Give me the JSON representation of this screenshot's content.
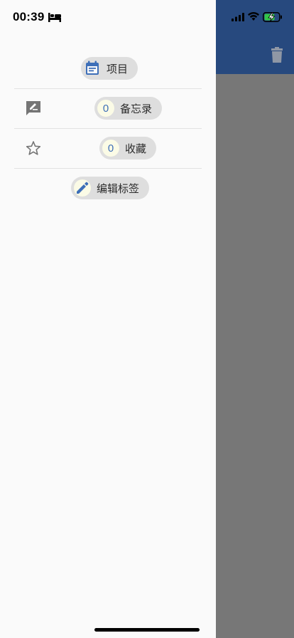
{
  "status_bar": {
    "time": "00:39"
  },
  "drawer": {
    "projects_label": "项目",
    "memo": {
      "count": "0",
      "label": "备忘录"
    },
    "favorites": {
      "count": "0",
      "label": "收藏"
    },
    "edit_tags_label": "编辑标签"
  },
  "colors": {
    "appbar": "#27497e",
    "accent": "#3e6fb8",
    "chip_bg": "#dedede",
    "scrim": "#777777"
  },
  "icons": [
    "bed-icon",
    "signal-icon",
    "wifi-icon",
    "battery-charging-icon",
    "trash-icon",
    "calendar-icon",
    "memo-edit-icon",
    "star-outline-icon",
    "pencil-icon"
  ]
}
